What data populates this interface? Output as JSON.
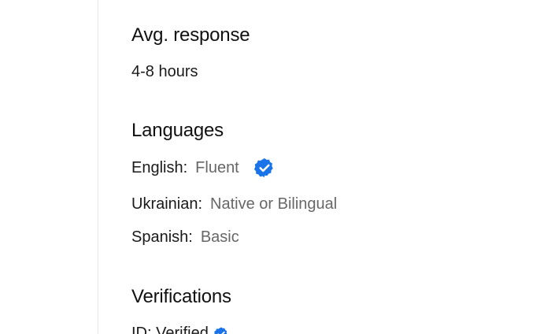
{
  "avg_response": {
    "heading": "Avg. response",
    "value": "4-8 hours"
  },
  "languages": {
    "heading": "Languages",
    "items": [
      {
        "name": "English:",
        "level": "Fluent",
        "verified": true
      },
      {
        "name": "Ukrainian:",
        "level": "Native or Bilingual",
        "verified": false
      },
      {
        "name": "Spanish:",
        "level": "Basic",
        "verified": false
      }
    ]
  },
  "verifications": {
    "heading": "Verifications",
    "items": [
      {
        "label": "ID: Verified",
        "verified": true
      }
    ]
  },
  "colors": {
    "verified_badge": "#1a73e8",
    "muted_text": "#676767",
    "divider": "#e6e6e6"
  },
  "icons": {
    "verified": "verified-badge-icon"
  }
}
